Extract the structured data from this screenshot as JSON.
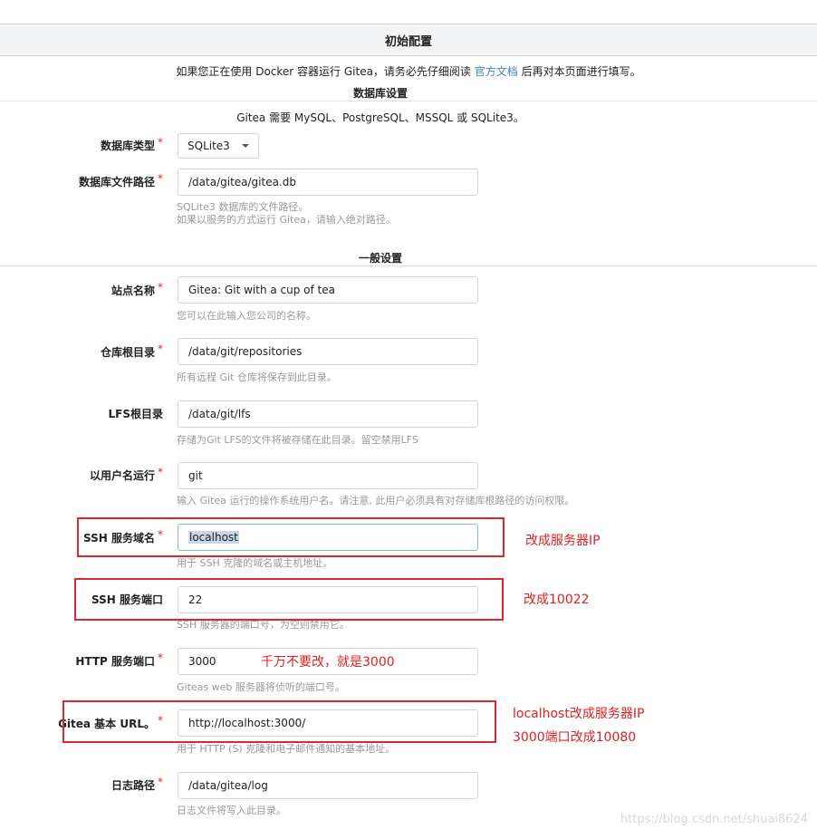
{
  "title": "初始配置",
  "notice": {
    "before": "如果您正在使用 Docker 容器运行 Gitea，请务必先仔细阅读 ",
    "link": "官方文档",
    "after": " 后再对本页面进行填写。"
  },
  "database": {
    "title": "数据库设置",
    "description": "Gitea 需要 MySQL、PostgreSQL、MSSQL 或 SQLite3。",
    "type_label": "数据库类型",
    "type_value": "SQLite3",
    "path_label": "数据库文件路径",
    "path_value": "/data/gitea/gitea.db",
    "path_help_1": "SQLite3 数据库的文件路径。",
    "path_help_2": "如果以服务的方式运行 Gitea，请输入绝对路径。"
  },
  "general": {
    "title": "一般设置",
    "site_name": {
      "label": "站点名称",
      "value": "Gitea: Git with a cup of tea",
      "help": "您可以在此输入您公司的名称。"
    },
    "repo_root": {
      "label": "仓库根目录",
      "value": "/data/git/repositories",
      "help": "所有远程 Git 仓库将保存到此目录。"
    },
    "lfs_root": {
      "label": "LFS根目录",
      "value": "/data/git/lfs",
      "help": "存储为Git LFS的文件将被存储在此目录。留空禁用LFS"
    },
    "run_user": {
      "label": "以用户名运行",
      "value": "git",
      "help": "输入 Gitea 运行的操作系统用户名。请注意, 此用户必须具有对存储库根路径的访问权限。"
    },
    "ssh_domain": {
      "label": "SSH 服务域名",
      "value": "localhost",
      "help": "用于 SSH 克隆的域名或主机地址。"
    },
    "ssh_port": {
      "label": "SSH 服务端口",
      "value": "22",
      "help": "SSH 服务器的端口号，为空则禁用它。"
    },
    "http_port": {
      "label": "HTTP 服务端口",
      "value": "3000",
      "help": "Giteas web 服务器将侦听的端口号。"
    },
    "base_url": {
      "label": "Gitea 基本 URL。",
      "value": "http://localhost:3000/",
      "help": "用于 HTTP (S) 克隆和电子邮件通知的基本地址。"
    },
    "log_path": {
      "label": "日志路径",
      "value": "/data/gitea/log",
      "help": "日志文件将写入此目录。"
    }
  },
  "annotations": {
    "ssh_domain": "改成服务器IP",
    "ssh_port": "改成10022",
    "http_port": "千万不要改，就是3000",
    "base_url_1": "localhost改成服务器IP",
    "base_url_2": "3000端口改成10080"
  },
  "required_mark": "*",
  "watermark": "https://blog.csdn.net/shuai8624",
  "colors": {
    "link": "#4183c4",
    "required": "#db2828",
    "annotation": "#e02020",
    "header_bg": "#f3f4f5"
  }
}
